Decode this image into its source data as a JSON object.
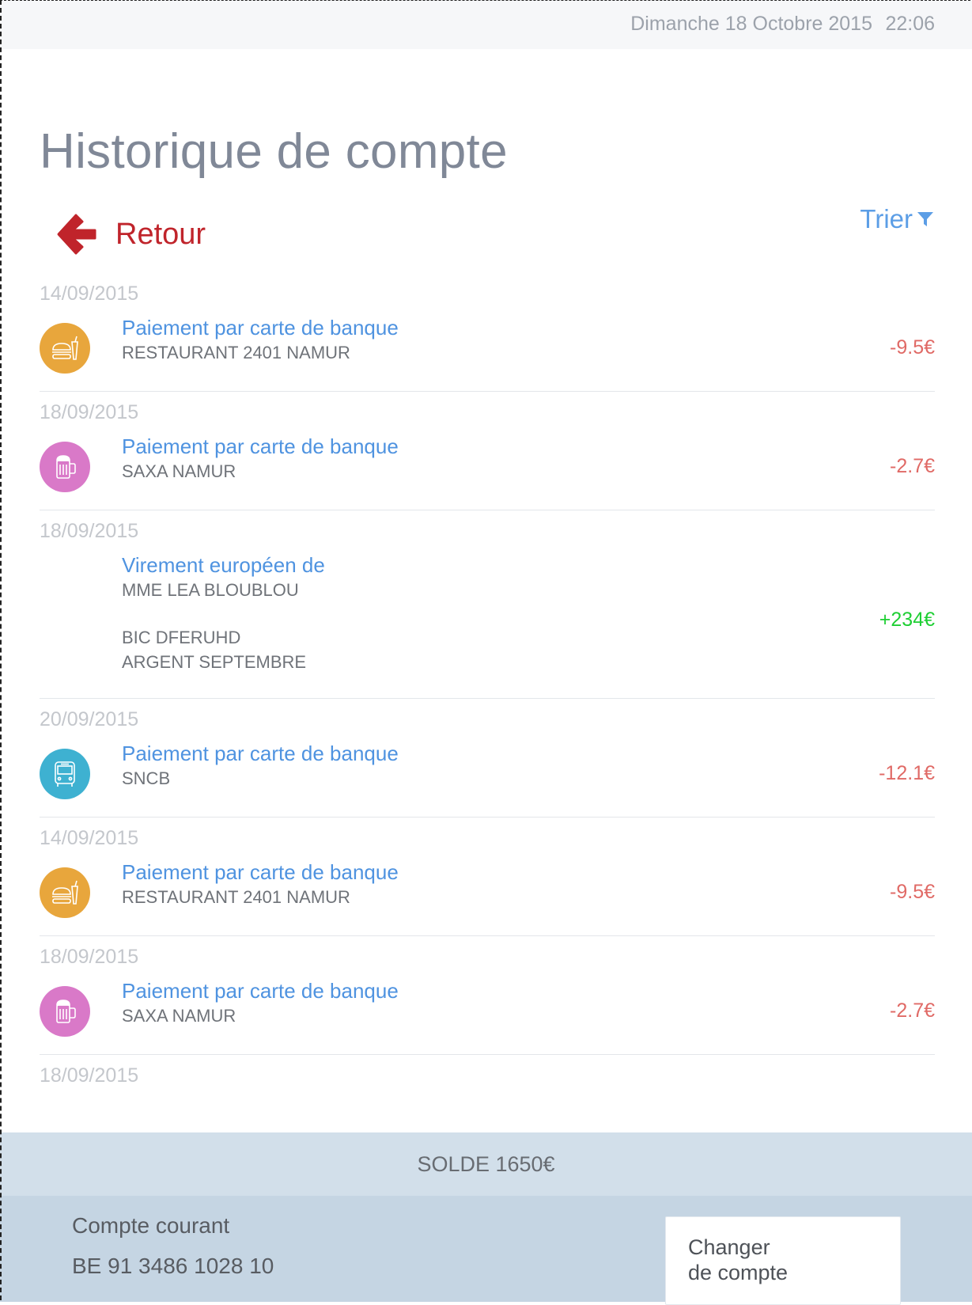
{
  "status": {
    "date": "Dimanche 18 Octobre 2015",
    "time": "22:06"
  },
  "page_title": "Historique de compte",
  "back_label": "Retour",
  "sort_label": "Trier",
  "transactions": [
    {
      "date": "14/09/2015",
      "icon": "restaurant-icon",
      "icon_color": "#e8a63c",
      "title": "Paiement par carte de banque",
      "lines": [
        "RESTAURANT 2401 NAMUR"
      ],
      "amount": "-9.5€",
      "sign": "negative"
    },
    {
      "date": "18/09/2015",
      "icon": "beer-icon",
      "icon_color": "#d979c8",
      "title": "Paiement par carte de banque",
      "lines": [
        "SAXA NAMUR"
      ],
      "amount": "-2.7€",
      "sign": "negative"
    },
    {
      "date": "18/09/2015",
      "icon": "",
      "icon_color": "",
      "title": "Virement européen de",
      "lines": [
        "MME LEA BLOUBLOU",
        "",
        "BIC DFERUHD",
        "ARGENT SEPTEMBRE"
      ],
      "amount": "+234€",
      "sign": "positive"
    },
    {
      "date": "20/09/2015",
      "icon": "bus-icon",
      "icon_color": "#3eb1d1",
      "title": "Paiement par carte de banque",
      "lines": [
        "SNCB"
      ],
      "amount": "-12.1€",
      "sign": "negative"
    },
    {
      "date": "14/09/2015",
      "icon": "restaurant-icon",
      "icon_color": "#e8a63c",
      "title": "Paiement par carte de banque",
      "lines": [
        "RESTAURANT 2401 NAMUR"
      ],
      "amount": "-9.5€",
      "sign": "negative"
    },
    {
      "date": "18/09/2015",
      "icon": "beer-icon",
      "icon_color": "#d979c8",
      "title": "Paiement par carte de banque",
      "lines": [
        "SAXA NAMUR"
      ],
      "amount": "-2.7€",
      "sign": "negative"
    },
    {
      "date": "18/09/2015"
    }
  ],
  "balance_label": "SOLDE 1650€",
  "account": {
    "name": "Compte courant",
    "iban": "BE 91 3486 1028 10"
  },
  "switch_account": {
    "line1": "Changer",
    "line2": "de compte"
  },
  "colors": {
    "accent_blue": "#4f93e0",
    "back_red": "#c0242b",
    "negative": "#e06a66",
    "positive": "#1fcf34"
  }
}
